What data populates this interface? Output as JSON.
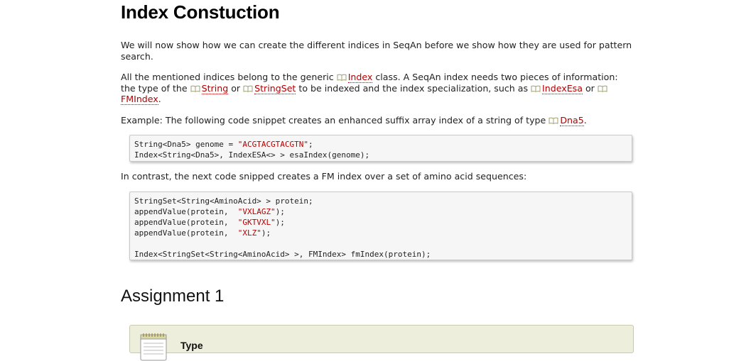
{
  "heading": "Index Constuction",
  "para1": "We will now show how we can create the different indices in SeqAn before we show how they are used for pattern search.",
  "para2": {
    "t1": "All the mentioned indices belong to the generic ",
    "link_index": "Index",
    "t2": " class. A SeqAn index needs two pieces of information: the type of the ",
    "link_string": "String",
    "t3": " or ",
    "link_stringset": "StringSet",
    "t4": " to be indexed and the index specialization, such as ",
    "link_indexesa": "IndexEsa",
    "t5": " or ",
    "link_fmindex": "FMIndex",
    "t6": "."
  },
  "para3": {
    "t1": "Example: The following code snippet creates an enhanced suffix array index of a string of type ",
    "link_dna5": "Dna5",
    "t2": "."
  },
  "code1": {
    "l1_a": "String<Dna5> genome = ",
    "l1_str": "\"ACGTACGTACGTN\"",
    "l1_b": ";",
    "l2": "Index<String<Dna5>, IndexESA<> > esaIndex(genome);"
  },
  "para4": "In contrast, the next code snipped creates a FM index over a set of amino acid sequences:",
  "code2": {
    "l1": "StringSet<String<AminoAcid> > protein;",
    "l2_a": "appendValue(protein,  ",
    "l2_str": "\"VXLAGZ\"",
    "l2_b": ");",
    "l3_a": "appendValue(protein,  ",
    "l3_str": "\"GKTVXL\"",
    "l3_b": ");",
    "l4_a": "appendValue(protein,  ",
    "l4_str": "\"XLZ\"",
    "l4_b": ");",
    "l6": "Index<StringSet<String<AminoAcid> >, FMIndex> fmIndex(protein);"
  },
  "assignment_heading": "Assignment 1",
  "type_box": {
    "label": "Type"
  },
  "colors": {
    "link": "#b40000",
    "code_bg": "#f6f6f6",
    "type_box_bg": "#eeeedd"
  }
}
